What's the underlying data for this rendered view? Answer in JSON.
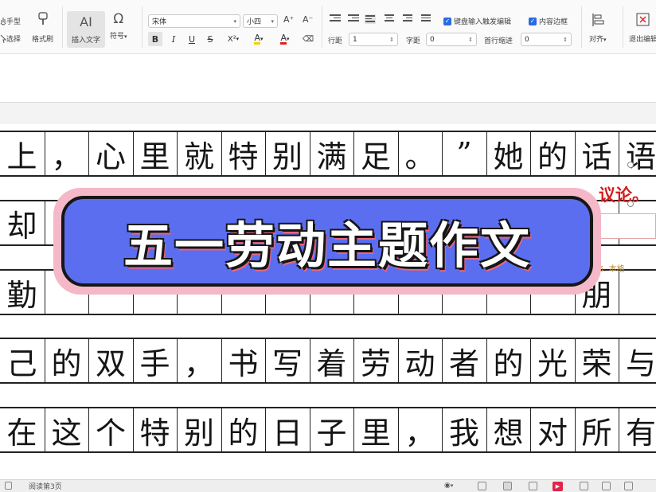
{
  "ribbon": {
    "hand_label": "手型",
    "select_label": "选择",
    "format_painter_label": "格式刷",
    "insert_text_icon": "AI",
    "insert_text_label": "插入文字",
    "symbol_icon": "Ω",
    "symbol_label": "符号",
    "font_name": "宋体",
    "font_size": "小四",
    "grow_font": "A⁺",
    "shrink_font": "A⁻",
    "bold": "B",
    "italic": "I",
    "underline": "U",
    "strike": "S",
    "superscript": "X²",
    "highlight": "A",
    "font_color": "A",
    "clear_format": "⌫",
    "line_spacing_label": "行距",
    "line_spacing_value": "1",
    "char_spacing_label": "字距",
    "char_spacing_value": "0",
    "first_indent_label": "首行缩进",
    "first_indent_value": "0",
    "keep_editing_label": "键盘输入触发编辑",
    "content_border_label": "内容边框",
    "align_label": "对齐",
    "exit_label": "退出编辑"
  },
  "document": {
    "rows": [
      [
        "上",
        "，",
        "心",
        "里",
        "就",
        "特",
        "别",
        "满",
        "足",
        "。",
        "”",
        "她",
        "的",
        "话",
        "语"
      ],
      [
        "却",
        "",
        "",
        "",
        "",
        "",
        "",
        "",
        "",
        "",
        "",
        "",
        "",
        "",
        ""
      ],
      [
        "勤",
        "",
        "",
        "",
        "",
        "",
        "",
        "",
        "",
        "",
        "",
        "",
        "",
        "朋",
        ""
      ],
      [
        "己",
        "的",
        "双",
        "手",
        "，",
        "书",
        "写",
        "着",
        "劳",
        "动",
        "者",
        "的",
        "光",
        "荣",
        "与"
      ],
      [
        "在",
        "这",
        "个",
        "特",
        "别",
        "的",
        "日",
        "子",
        "里",
        "，",
        "我",
        "想",
        "对",
        "所",
        "有"
      ]
    ],
    "annotation_red": "议论。",
    "annotation_gray": "5. 本格"
  },
  "banner": {
    "title": "五一劳动主题作文"
  },
  "status_bar": {
    "page_info": "阅读第3页"
  },
  "colors": {
    "banner_fill": "#5c6ef0",
    "banner_glow": "#f4b8c9",
    "title_shadow": "#e8667f",
    "annotation_red": "#d51b1b",
    "checkbox_blue": "#2a6ae0",
    "play_red": "#e0264a"
  }
}
